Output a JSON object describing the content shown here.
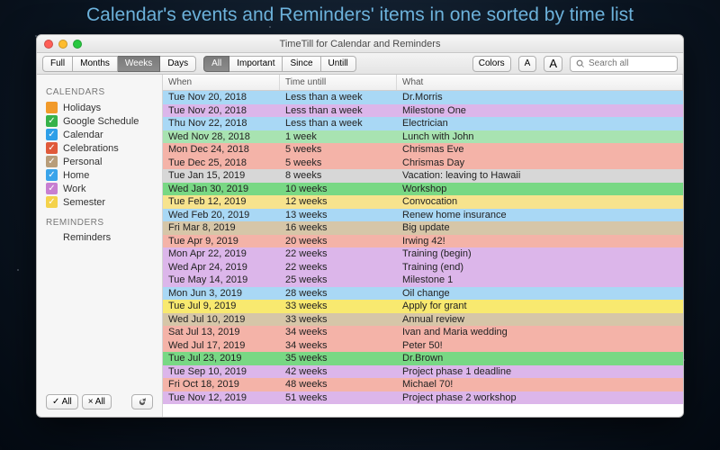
{
  "headline": "Calendar's events and Reminders' items in one sorted by time list",
  "window": {
    "title": "TimeTill for Calendar and Reminders"
  },
  "toolbar": {
    "view_segments": [
      "Full",
      "Months",
      "Weeks",
      "Days"
    ],
    "view_active_index": 2,
    "filter_segments": [
      "All",
      "Important",
      "Since",
      "Untill"
    ],
    "filter_active_index": 0,
    "colors_label": "Colors",
    "font_small": "A",
    "font_large": "A",
    "search_placeholder": "Search all"
  },
  "sidebar": {
    "calendars_header": "CALENDARS",
    "reminders_header": "REMINDERS",
    "reminders_item": "Reminders",
    "check_all": "✓ All",
    "uncheck_all": "× All",
    "items": [
      {
        "label": "Holidays",
        "color": "#f19a2a",
        "checked": false
      },
      {
        "label": "Google Schedule",
        "color": "#36b24a",
        "checked": true
      },
      {
        "label": "Calendar",
        "color": "#2e9fe8",
        "checked": true
      },
      {
        "label": "Celebrations",
        "color": "#e05a3b",
        "checked": true
      },
      {
        "label": "Personal",
        "color": "#b89d7a",
        "checked": true
      },
      {
        "label": "Home",
        "color": "#3aa4ea",
        "checked": true
      },
      {
        "label": "Work",
        "color": "#c77fd1",
        "checked": true
      },
      {
        "label": "Semester",
        "color": "#f4d24b",
        "checked": true
      }
    ]
  },
  "columns": {
    "when": "When",
    "until": "Time untill",
    "what": "What"
  },
  "colors": {
    "blue": "#a9d8f5",
    "green": "#a8e3b1",
    "accentgreen": "#78d884",
    "purple": "#dcb6ea",
    "yellow": "#f7e38d",
    "tan": "#d6c6a8",
    "gray": "#d7d7d7",
    "red": "#f4b3a8",
    "brightyellow": "#f8e96f"
  },
  "rows": [
    {
      "when": "Tue Nov 20, 2018",
      "until": "Less than a week",
      "what": "Dr.Morris",
      "c": "blue"
    },
    {
      "when": "Tue Nov 20, 2018",
      "until": "Less than a week",
      "what": "Milestone One",
      "c": "purple"
    },
    {
      "when": "Thu Nov 22, 2018",
      "until": "Less than a week",
      "what": "Electrician",
      "c": "blue"
    },
    {
      "when": "Wed Nov 28, 2018",
      "until": "1 week",
      "what": "Lunch with John",
      "c": "green"
    },
    {
      "when": "Mon Dec 24, 2018",
      "until": "5 weeks",
      "what": "Chrismas Eve",
      "c": "red"
    },
    {
      "when": "Tue Dec 25, 2018",
      "until": "5 weeks",
      "what": "Chrismas Day",
      "c": "red"
    },
    {
      "when": "Tue Jan 15, 2019",
      "until": "8 weeks",
      "what": "Vacation: leaving to Hawaii",
      "c": "gray"
    },
    {
      "when": "Wed Jan 30, 2019",
      "until": "10 weeks",
      "what": "Workshop",
      "c": "accentgreen"
    },
    {
      "when": "Tue Feb 12, 2019",
      "until": "12 weeks",
      "what": "Convocation",
      "c": "yellow"
    },
    {
      "when": "Wed Feb 20, 2019",
      "until": "13 weeks",
      "what": "Renew home insurance",
      "c": "blue"
    },
    {
      "when": "Fri Mar 8, 2019",
      "until": "16 weeks",
      "what": "Big update",
      "c": "tan"
    },
    {
      "when": "Tue Apr 9, 2019",
      "until": "20 weeks",
      "what": "Irwing 42!",
      "c": "red"
    },
    {
      "when": "Mon Apr 22, 2019",
      "until": "22 weeks",
      "what": "Training (begin)",
      "c": "purple"
    },
    {
      "when": "Wed Apr 24, 2019",
      "until": "22 weeks",
      "what": "Training (end)",
      "c": "purple"
    },
    {
      "when": "Tue May 14, 2019",
      "until": "25 weeks",
      "what": "Milestone 1",
      "c": "purple"
    },
    {
      "when": "Mon Jun 3, 2019",
      "until": "28 weeks",
      "what": "Oil change",
      "c": "blue"
    },
    {
      "when": "Tue Jul 9, 2019",
      "until": "33 weeks",
      "what": "Apply for grant",
      "c": "brightyellow"
    },
    {
      "when": "Wed Jul 10, 2019",
      "until": "33 weeks",
      "what": "Annual review",
      "c": "tan"
    },
    {
      "when": "Sat Jul 13, 2019",
      "until": "34 weeks",
      "what": "Ivan and Maria wedding",
      "c": "red"
    },
    {
      "when": "Wed Jul 17, 2019",
      "until": "34 weeks",
      "what": "Peter 50!",
      "c": "red"
    },
    {
      "when": "Tue Jul 23, 2019",
      "until": "35 weeks",
      "what": "Dr.Brown",
      "c": "accentgreen"
    },
    {
      "when": "Tue Sep 10, 2019",
      "until": "42 weeks",
      "what": "Project phase 1 deadline",
      "c": "purple"
    },
    {
      "when": "Fri Oct 18, 2019",
      "until": "48 weeks",
      "what": "Michael 70!",
      "c": "red"
    },
    {
      "when": "Tue Nov 12, 2019",
      "until": "51 weeks",
      "what": "Project phase 2 workshop",
      "c": "purple"
    }
  ]
}
